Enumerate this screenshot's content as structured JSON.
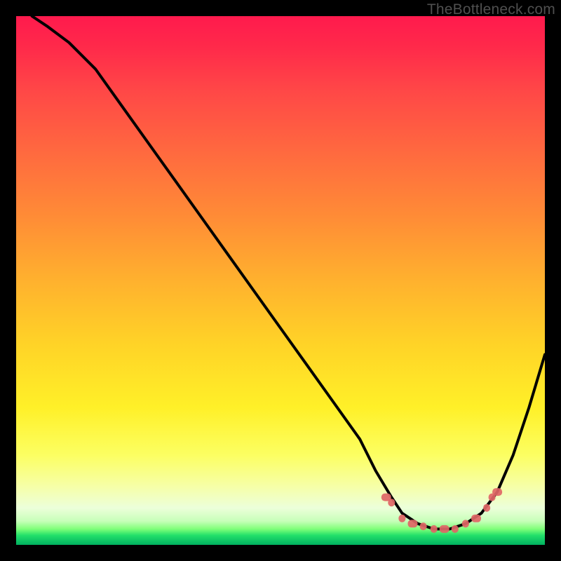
{
  "watermark": "TheBottleneck.com",
  "colors": {
    "frame": "#000000",
    "curve": "#000000",
    "markers": "#e06666",
    "gradient_top": "#ff1a4d",
    "gradient_bottom": "#00b060"
  },
  "chart_data": {
    "type": "line",
    "title": "",
    "xlabel": "",
    "ylabel": "",
    "xlim": [
      0,
      100
    ],
    "ylim": [
      0,
      100
    ],
    "grid": false,
    "legend": false,
    "note": "Values are read off the image as percentages of the inner plot area (origin bottom-left). The curve is a bottleneck-style V: steep descent from top-left, a flat minimum near the right, then a rise to the right edge.",
    "series": [
      {
        "name": "bottleneck-curve",
        "x": [
          3,
          6,
          10,
          15,
          20,
          25,
          30,
          35,
          40,
          45,
          50,
          55,
          60,
          65,
          68,
          71,
          73,
          76,
          79,
          82,
          85,
          88,
          91,
          94,
          97,
          100
        ],
        "y": [
          100,
          98,
          95,
          90,
          83,
          76,
          69,
          62,
          55,
          48,
          41,
          34,
          27,
          20,
          14,
          9,
          6,
          4,
          3,
          3,
          4,
          6,
          10,
          17,
          26,
          36
        ]
      }
    ],
    "markers": {
      "name": "highlighted-points",
      "note": "Clustered salmon dots/dashes along the flat bottom and lower rise of the curve.",
      "points": [
        {
          "x": 70,
          "y": 9
        },
        {
          "x": 71,
          "y": 8
        },
        {
          "x": 73,
          "y": 5
        },
        {
          "x": 75,
          "y": 4
        },
        {
          "x": 77,
          "y": 3.5
        },
        {
          "x": 79,
          "y": 3
        },
        {
          "x": 81,
          "y": 3
        },
        {
          "x": 83,
          "y": 3
        },
        {
          "x": 85,
          "y": 4
        },
        {
          "x": 87,
          "y": 5
        },
        {
          "x": 89,
          "y": 7
        },
        {
          "x": 90,
          "y": 9
        },
        {
          "x": 91,
          "y": 10
        }
      ]
    }
  }
}
